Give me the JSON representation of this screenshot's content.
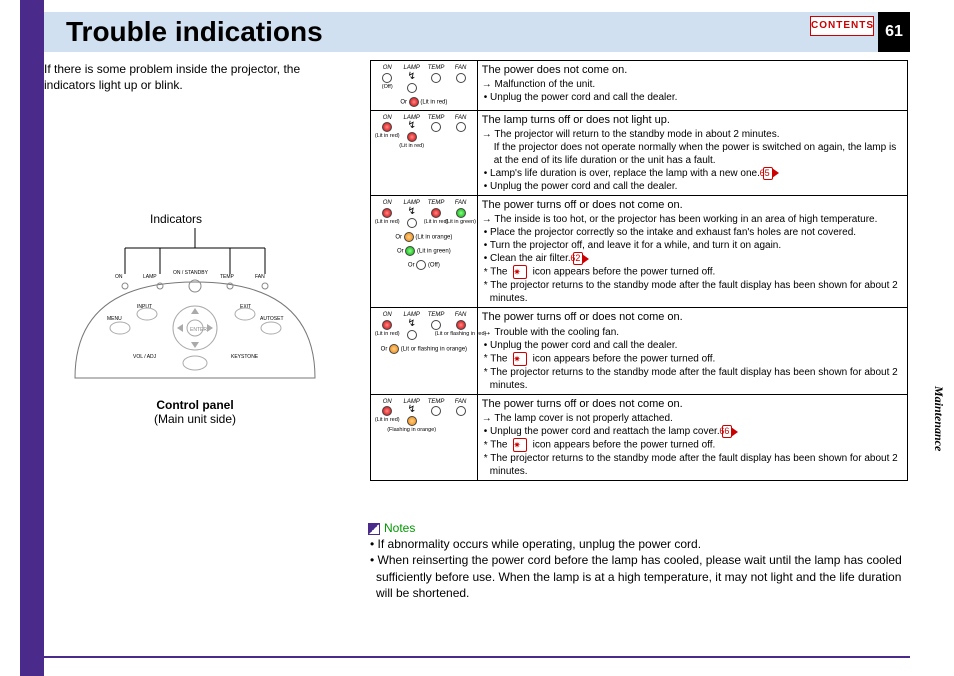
{
  "header": {
    "title": "Trouble indications",
    "contents_label": "CONTENTS",
    "page_number": "61"
  },
  "intro": "If there is some problem inside the projector, the indicators light up or blink.",
  "figure": {
    "indicators_label": "Indicators",
    "panel_bold": "Control panel",
    "panel_sub": "(Main unit side)",
    "labels": {
      "on": "ON",
      "standby": "ON / STANDBY",
      "lamp": "LAMP",
      "temp": "TEMP",
      "fan": "FAN",
      "menu": "MENU",
      "input": "INPUT",
      "exit": "EXIT",
      "auto": "AUTOSET",
      "vol": "VOL / ADJ",
      "enter": "ENTER",
      "key": "KEYSTONE"
    }
  },
  "indicator_names": {
    "on": "ON",
    "lamp": "LAMP",
    "temp": "TEMP",
    "fan": "FAN",
    "or": "Or"
  },
  "states": {
    "off": "(Off)",
    "lit_red": "(Lit in red)",
    "lit_green": "(Lit in green)",
    "lit_orange": "(Lit in orange)",
    "lit_or_flash_red": "(Lit or flashing in red)",
    "lit_or_flash_orange": "(Lit or flashing in orange)",
    "flash_orange": "(Flashing in orange)"
  },
  "rows": [
    {
      "title": "The power does not come on.",
      "cause": "Malfunction of the unit.",
      "bullets": [
        "Unplug the power cord and call the dealer."
      ]
    },
    {
      "title": "The lamp turns off or does not light up.",
      "cause": "The projector will return to the standby mode in about 2 minutes.",
      "cause2": "If the projector does not operate normally when the power is switched on again, the lamp is at the end of its life duration or the unit has a fault.",
      "bullets": [
        "Lamp's life duration is over, replace the lamp with a new one.",
        "Unplug the power cord and call the dealer."
      ],
      "ref": "65"
    },
    {
      "title": "The power turns off or does not come on.",
      "cause": "The inside is too hot, or the projector has been working in an area of high temperature.",
      "bullets": [
        "Place the projector correctly so the intake and exhaust fan's holes are not covered.",
        "Turn the projector off, and leave it for a while, and turn it on again.",
        "Clean the air filter."
      ],
      "ref": "62",
      "stars": [
        "The        icon appears before the power turned off.",
        "The projector returns to the standby mode after the fault display has been shown for about 2 minutes."
      ]
    },
    {
      "title": "The power turns off or does not come on.",
      "cause": "Trouble with the cooling fan.",
      "bullets": [
        "Unplug the power cord and call the dealer."
      ],
      "stars": [
        "The        icon appears before the power turned off.",
        "The projector returns to the standby mode after the fault display has been shown for about 2 minutes."
      ]
    },
    {
      "title": "The power turns off or does not come on.",
      "cause": "The lamp cover is not properly attached.",
      "bullets": [
        "Unplug the power cord and reattach the lamp cover."
      ],
      "ref": "66",
      "stars": [
        "The        icon appears before the power turned off.",
        "The projector returns to the standby mode after the fault display has been shown for about 2 minutes."
      ]
    }
  ],
  "notes": {
    "header": "Notes",
    "items": [
      "If abnormality occurs while operating, unplug the power cord.",
      "When reinserting the power cord before the lamp has cooled, please wait until the lamp has cooled sufficiently before use. When the lamp is at a high temperature, it may not light and the life duration will be shortened."
    ]
  },
  "side_tab": "Maintenance"
}
